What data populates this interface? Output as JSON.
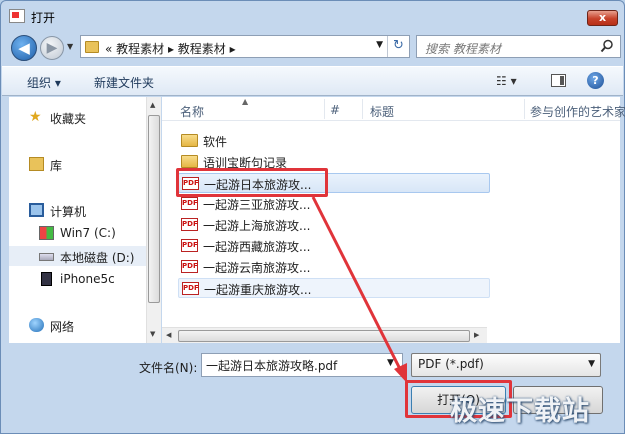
{
  "window": {
    "title": "打开",
    "close_label": "x"
  },
  "nav": {
    "back": "◀",
    "forward": "▶",
    "address_path": "« 教程素材 ▸ 教程素材 ▸",
    "refresh": "↻",
    "search_placeholder": "搜索 教程素材"
  },
  "toolbar": {
    "organize": "组织 ▾",
    "new_folder": "新建文件夹",
    "views": "☷ ▾",
    "help": "?"
  },
  "sidebar": {
    "items": [
      {
        "label": "收藏夹",
        "icon": "star-icon"
      },
      {
        "label": "库",
        "icon": "library-icon"
      },
      {
        "label": "计算机",
        "icon": "computer-icon"
      },
      {
        "label": "Win7 (C:)",
        "icon": "windows-drive-icon"
      },
      {
        "label": "本地磁盘 (D:)",
        "icon": "disk-drive-icon"
      },
      {
        "label": "iPhone5c",
        "icon": "phone-icon"
      },
      {
        "label": "网络",
        "icon": "network-icon"
      }
    ]
  },
  "columns": {
    "name": "名称",
    "number": "#",
    "title": "标题",
    "artist": "参与创作的艺术家"
  },
  "files": [
    {
      "name": "软件",
      "type": "folder"
    },
    {
      "name": "语训宝断句记录",
      "type": "folder"
    },
    {
      "name": "一起游日本旅游攻...",
      "type": "pdf",
      "pdf_label": "PDF"
    },
    {
      "name": "一起游三亚旅游攻...",
      "type": "pdf",
      "pdf_label": "PDF"
    },
    {
      "name": "一起游上海旅游攻...",
      "type": "pdf",
      "pdf_label": "PDF"
    },
    {
      "name": "一起游西藏旅游攻...",
      "type": "pdf",
      "pdf_label": "PDF"
    },
    {
      "name": "一起游云南旅游攻...",
      "type": "pdf",
      "pdf_label": "PDF"
    },
    {
      "name": "一起游重庆旅游攻...",
      "type": "pdf",
      "pdf_label": "PDF"
    }
  ],
  "bottom": {
    "filename_label": "文件名(N):",
    "filename_value": "一起游日本旅游攻略.pdf",
    "filter_value": "PDF (*.pdf)",
    "open_label": "打开(O)"
  },
  "watermark": "极速下载站",
  "colors": {
    "highlight": "#e0343a",
    "selection": "#d8e6f7",
    "chrome": "#c4d7ed"
  }
}
